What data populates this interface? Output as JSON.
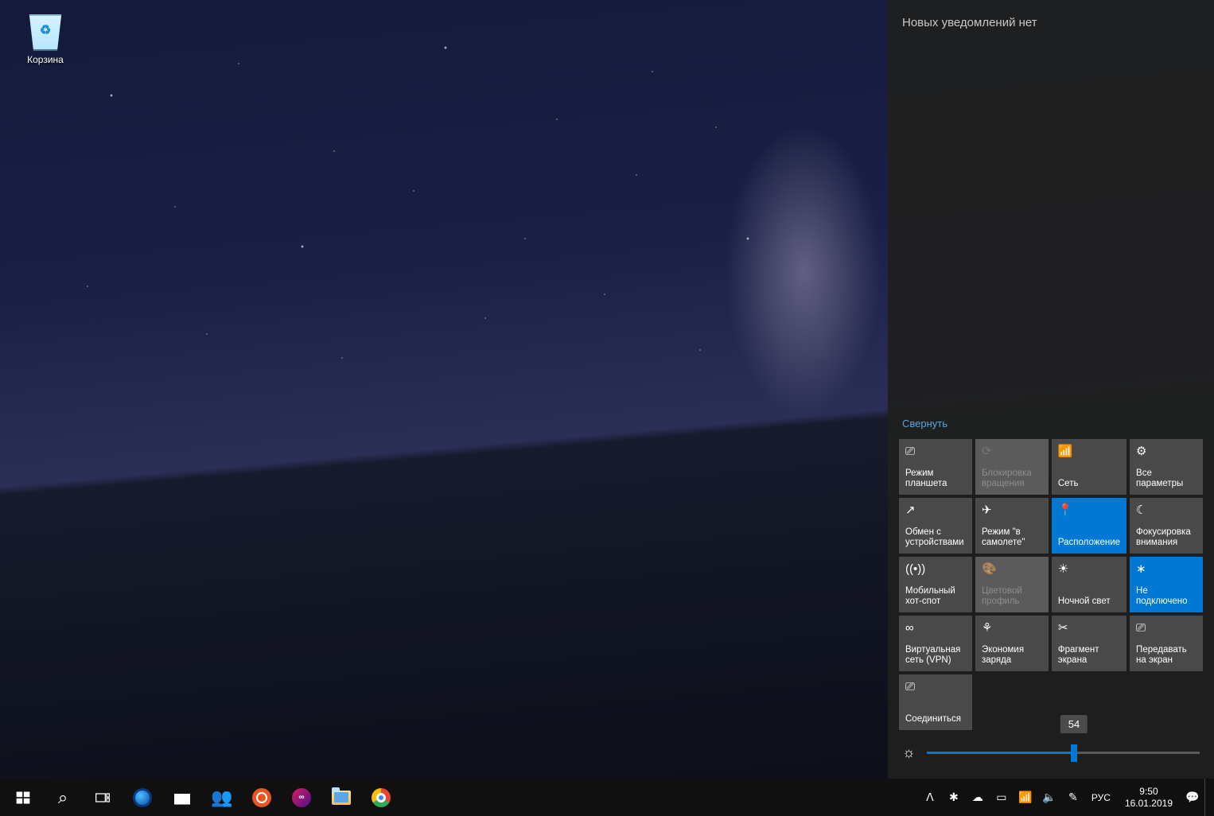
{
  "desktop": {
    "recycle_bin": "Корзина"
  },
  "action_center": {
    "header": "Новых уведомлений нет",
    "collapse": "Свернуть",
    "tiles": [
      {
        "id": "tablet-mode",
        "icon": "⎚",
        "label": "Режим планшета",
        "state": "normal"
      },
      {
        "id": "rotation-lock",
        "icon": "⟳",
        "label": "Блокировка вращения",
        "state": "disabled"
      },
      {
        "id": "network",
        "icon": "📶",
        "label": "Сеть",
        "state": "normal"
      },
      {
        "id": "all-settings",
        "icon": "⚙",
        "label": "Все параметры",
        "state": "normal"
      },
      {
        "id": "nearby-sharing",
        "icon": "↗",
        "label": "Обмен с устройствами",
        "state": "normal"
      },
      {
        "id": "airplane-mode",
        "icon": "✈",
        "label": "Режим \"в самолете\"",
        "state": "normal"
      },
      {
        "id": "location",
        "icon": "📍",
        "label": "Расположение",
        "state": "active"
      },
      {
        "id": "focus-assist",
        "icon": "☾",
        "label": "Фокусировка внимания",
        "state": "normal"
      },
      {
        "id": "mobile-hotspot",
        "icon": "((•))",
        "label": "Мобильный хот-спот",
        "state": "normal"
      },
      {
        "id": "color-profile",
        "icon": "🎨",
        "label": "Цветовой профиль",
        "state": "disabled"
      },
      {
        "id": "night-light",
        "icon": "☀",
        "label": "Ночной свет",
        "state": "normal"
      },
      {
        "id": "bluetooth",
        "icon": "∗",
        "label": "Не подключено",
        "state": "active"
      },
      {
        "id": "vpn",
        "icon": "∞",
        "label": "Виртуальная сеть (VPN)",
        "state": "normal"
      },
      {
        "id": "battery-saver",
        "icon": "⚘",
        "label": "Экономия заряда",
        "state": "normal"
      },
      {
        "id": "screen-snip",
        "icon": "✂",
        "label": "Фрагмент экрана",
        "state": "normal"
      },
      {
        "id": "project",
        "icon": "⎚",
        "label": "Передавать на экран",
        "state": "normal"
      },
      {
        "id": "connect",
        "icon": "⎚",
        "label": "Соединиться",
        "state": "normal"
      }
    ],
    "brightness": {
      "value": 54
    }
  },
  "taskbar": {
    "left": [
      {
        "id": "start",
        "name": "start-button",
        "kind": "svg-windows"
      },
      {
        "id": "search",
        "name": "search-button",
        "kind": "glyph",
        "glyph": "⌕"
      },
      {
        "id": "taskview",
        "name": "taskview-button",
        "kind": "svg-taskview"
      },
      {
        "id": "edge",
        "name": "edge-button",
        "kind": "edge"
      },
      {
        "id": "store",
        "name": "store-button",
        "kind": "store"
      },
      {
        "id": "people",
        "name": "people-button",
        "kind": "people"
      },
      {
        "id": "ubuntu",
        "name": "ubuntu-button",
        "kind": "ubuntu"
      },
      {
        "id": "creative-cloud",
        "name": "creative-cloud-button",
        "kind": "cc"
      },
      {
        "id": "explorer",
        "name": "file-explorer-button",
        "kind": "explorer"
      },
      {
        "id": "chrome",
        "name": "chrome-button",
        "kind": "chrome"
      }
    ],
    "tray": {
      "overflow": "ᐱ",
      "icons": [
        {
          "id": "settings-menu",
          "glyph": "✱"
        },
        {
          "id": "onedrive",
          "glyph": "☁"
        },
        {
          "id": "battery",
          "glyph": "▭"
        },
        {
          "id": "wifi",
          "glyph": "📶"
        },
        {
          "id": "volume",
          "glyph": "🔈"
        },
        {
          "id": "pen",
          "glyph": "✎"
        }
      ],
      "language": "РУС",
      "time": "9:50",
      "date": "16.01.2019",
      "notifications": "💬"
    }
  }
}
